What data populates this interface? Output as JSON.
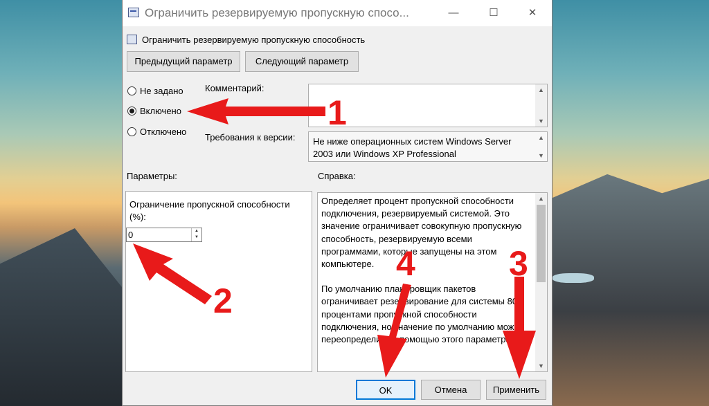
{
  "window": {
    "title": "Ограничить резервируемую пропускную спосо...",
    "minimize_glyph": "—",
    "maximize_glyph": "☐",
    "close_glyph": "✕"
  },
  "header": {
    "policy_name": "Ограничить резервируемую пропускную способность",
    "icon": "policy-icon"
  },
  "nav": {
    "prev_label": "Предыдущий параметр",
    "next_label": "Следующий параметр"
  },
  "state": {
    "options": [
      "Не задано",
      "Включено",
      "Отключено"
    ],
    "selected": "Включено"
  },
  "comment": {
    "label": "Комментарий:",
    "value": ""
  },
  "requirements": {
    "label": "Требования к версии:",
    "value_line1": "Не ниже операционных систем Windows Server",
    "value_line2": "2003 или Windows XP Professional"
  },
  "params": {
    "label": "Параметры:",
    "field_label_line1": "Ограничение пропускной способности",
    "field_label_line2": "(%):",
    "field_value": "0"
  },
  "help": {
    "label": "Справка:",
    "para1": "Определяет процент пропускной способности подключения, резервируемый системой. Это значение ограничивает совокупную пропускную способность, резервируемую всеми программами, которые запущены на этом компьютере.",
    "para2": "По умолчанию планировщик пакетов ограничивает резервирование для системы 80 процентами пропускной способности подключения, но значение по умолчанию можно переопределить с помощью этого параметра."
  },
  "buttons": {
    "ok": "OK",
    "cancel": "Отмена",
    "apply": "Применить"
  },
  "annotations": {
    "color": "#e81a1a",
    "labels": [
      "1",
      "2",
      "3",
      "4"
    ]
  }
}
